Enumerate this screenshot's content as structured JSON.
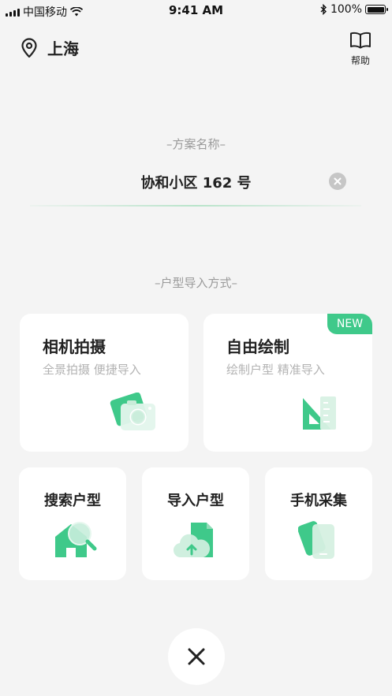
{
  "status_bar": {
    "carrier": "中国移动",
    "time": "9:41 AM",
    "battery": "100%"
  },
  "header": {
    "location": "上海",
    "help_label": "帮助"
  },
  "scheme": {
    "section_label": "–方案名称–",
    "name_value": "协和小区 162 号"
  },
  "import": {
    "section_label": "–户型导入方式–",
    "big_cards": [
      {
        "title": "相机拍摄",
        "subtitle": "全景拍摄 便捷导入"
      },
      {
        "title": "自由绘制",
        "subtitle": "绘制户型 精准导入",
        "badge": "NEW"
      }
    ],
    "small_cards": [
      {
        "title": "搜索户型",
        "icon": "house-search-icon"
      },
      {
        "title": "导入户型",
        "icon": "cloud-upload-icon"
      },
      {
        "title": "手机采集",
        "icon": "phone-icon"
      }
    ]
  },
  "colors": {
    "accent": "#3fc98a",
    "background": "#f4f4f4"
  }
}
